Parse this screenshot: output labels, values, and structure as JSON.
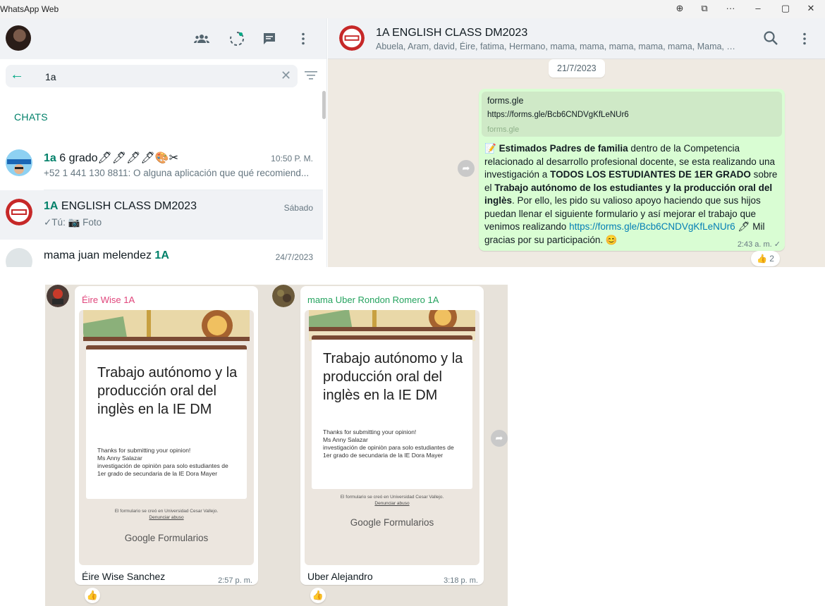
{
  "app": {
    "title": "WhatsApp Web"
  },
  "window_controls": [
    "⊕",
    "⧉",
    "···",
    "–",
    "▢",
    "✕"
  ],
  "sidebar": {
    "header_icons": [
      "communities-icon",
      "status-icon",
      "new-chat-icon",
      "menu-icon"
    ],
    "search": {
      "value": "1a"
    },
    "section_label": "CHATS",
    "chats": [
      {
        "name_highlight": "1a",
        "name_rest": " 6 grado🖊🖊🖊🖊🎨✂",
        "time": "10:50 P. M.",
        "preview": "+52 1 441 130 8811: O alguna aplicación que qué recomiend..."
      },
      {
        "name_highlight": "1A",
        "name_rest": " ENGLISH CLASS DM2023",
        "time": "Sábado",
        "preview": "✓Tú: 📷 Foto"
      },
      {
        "name_rest_prefix": "mama juan melendez ",
        "name_highlight": "1A",
        "time": "24/7/2023",
        "preview": ""
      }
    ]
  },
  "conversation": {
    "title": "1A ENGLISH CLASS DM2023",
    "members": "Abuela, Aram, david, Éire, fatima, Hermano, mama, mama, mama, mama, mama, Mama, mam...",
    "date": "21/7/2023",
    "message": {
      "link_preview": {
        "title": "forms.gle",
        "url": "https://forms.gle/Bcb6CNDVgKfLeNUr6",
        "domain": "forms.gle"
      },
      "emoji_start": "📝",
      "bold_1": "Estimados Padres de familia",
      "text_1": " dentro de la Competencia relacionado al desarrollo profesional docente, se esta realizando una investigación a ",
      "bold_2": "TODOS LOS ESTUDIANTES DE 1ER GRADO",
      "text_2": " sobre el ",
      "bold_3": "Trabajo autónomo de los estudiantes y la producción oral del inglès",
      "text_3": ". Por ello, les pido su valioso apoyo haciendo que sus hijos puedan llenar el siguiente formulario y así mejorar el trabajo que venimos realizando ",
      "link": "https://forms.gle/Bcb6CNDVgKfLeNUr6",
      "text_4": " 🖊 Mil gracias por su participación. 😊",
      "time": "2:43 a. m. ✓",
      "reaction": "👍 2"
    }
  },
  "photo_messages": [
    {
      "sender": "Éire Wise 1A",
      "sender_color": "#e0457b",
      "form_title": "Trabajo autónomo y la producción oral del inglès en la IE DM",
      "form_body": [
        "Thanks for submitting your opinion!",
        "Ms Anny Salazar",
        "investigación de opiniòn para solo estudiantes de 1er grado de secundaria de la IE Dora Mayer"
      ],
      "form_footer": "El formulario se creó en Universidad Cesar Vallejo.",
      "form_report": "Denunciar abuso",
      "form_brand": "Google Formularios",
      "caption": "Éire Wise Sanchez",
      "time": "2:57 p. m.",
      "reaction": "👍"
    },
    {
      "sender": "mama Uber Rondon Romero 1A",
      "sender_color": "#25a35f",
      "form_title": "Trabajo autónomo y la producción oral del inglès en la IE DM",
      "form_body": [
        "Thanks for submitting your opinion!",
        "Ms Anny Salazar",
        "investigación de opiniòn para solo estudiantes de 1er grado de secundaria de la IE Dora Mayer"
      ],
      "form_footer": "El formulario se creó en Universidad Cesar Vallejo.",
      "form_report": "Denunciar abuso",
      "form_brand": "Google Formularios",
      "caption": "Uber Alejandro",
      "time": "3:18 p. m.",
      "reaction": "👍"
    }
  ]
}
